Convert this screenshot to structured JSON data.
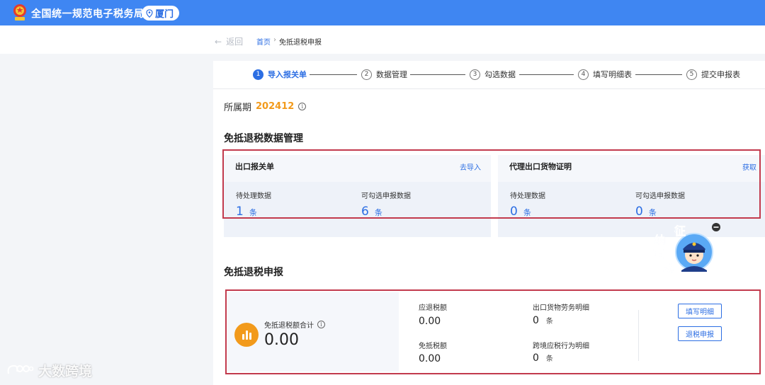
{
  "header": {
    "app_title": "全国统一规范电子税务局",
    "city": "厦门"
  },
  "nav": {
    "back_label": "返回",
    "breadcrumb_home": "首页",
    "breadcrumb_sep": "›",
    "breadcrumb_current": "免抵退税申报"
  },
  "stepper": {
    "steps": [
      {
        "num": "1",
        "label": "导入报关单",
        "active": true
      },
      {
        "num": "2",
        "label": "数据管理"
      },
      {
        "num": "3",
        "label": "勾选数据"
      },
      {
        "num": "4",
        "label": "填写明细表"
      },
      {
        "num": "5",
        "label": "提交申报表"
      }
    ]
  },
  "period": {
    "label": "所属期",
    "value": "202412",
    "info": "i"
  },
  "data_mgmt": {
    "title": "免抵退税数据管理",
    "cards": [
      {
        "title": "出口报关单",
        "link": "去导入",
        "pending_label": "待处理数据",
        "pending_value": "1",
        "selectable_label": "可勾选申报数据",
        "selectable_value": "6",
        "unit": "条"
      },
      {
        "title": "代理出口货物证明",
        "link": "获取",
        "pending_label": "待处理数据",
        "pending_value": "0",
        "selectable_label": "可勾选申报数据",
        "selectable_value": "0",
        "unit": "条"
      }
    ]
  },
  "mascot": {
    "chars": [
      "征",
      "纳",
      "互",
      "动"
    ]
  },
  "refund": {
    "title": "免抵退税申报",
    "total_label": "免抵退税额合计",
    "total_info": "i",
    "total_value": "0.00",
    "should_refund_label": "应退税额",
    "should_refund_value": "0.00",
    "exempt_label": "免抵税额",
    "exempt_value": "0.00",
    "export_detail_label": "出口货物劳务明细",
    "export_detail_count": "0",
    "crossborder_label": "跨境应税行为明细",
    "crossborder_count": "0",
    "unit": "条",
    "fill_button": "填写明细",
    "declare_button": "退税申报"
  },
  "watermark": {
    "text": "大数跨境"
  },
  "colors": {
    "header_blue": "#3f86f2",
    "link_blue": "#2c6ee3",
    "accent_orange": "#f29a1b",
    "highlight_red": "#c23a4d"
  }
}
